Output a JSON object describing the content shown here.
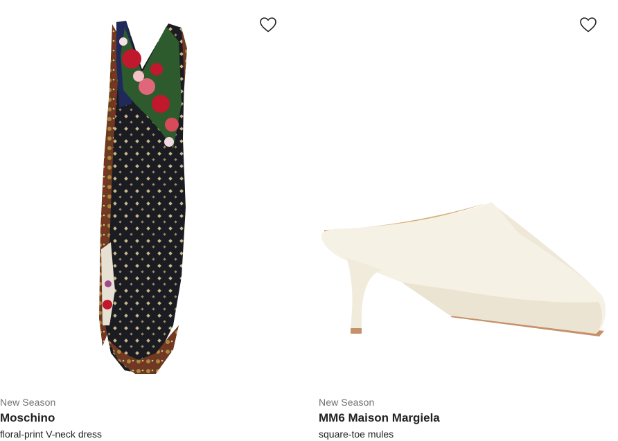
{
  "products": [
    {
      "label": "New Season",
      "brand": "Moschino",
      "description": "floral-print V-neck dress",
      "image_icon": "dress-image",
      "wishlist_icon": "heart-outline-icon",
      "colors": {
        "base": "#1b1b22",
        "accent": "#c0182d"
      }
    },
    {
      "label": "New Season",
      "brand": "MM6 Maison Margiela",
      "description": "square-toe mules",
      "image_icon": "mule-shoe-image",
      "wishlist_icon": "heart-outline-icon",
      "colors": {
        "base": "#f6f1e5",
        "accent": "#c6916a"
      }
    }
  ]
}
